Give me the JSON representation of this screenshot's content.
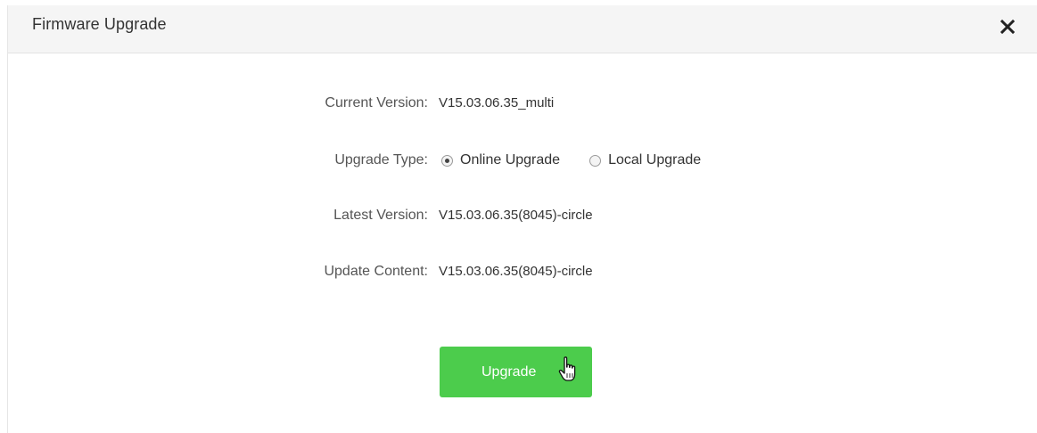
{
  "dialog": {
    "title": "Firmware Upgrade",
    "close_icon": "close-icon"
  },
  "fields": {
    "current_version": {
      "label": "Current Version:",
      "value": "V15.03.06.35_multi"
    },
    "upgrade_type": {
      "label": "Upgrade Type:",
      "options": [
        {
          "label": "Online Upgrade",
          "checked": true
        },
        {
          "label": "Local Upgrade",
          "checked": false
        }
      ]
    },
    "latest_version": {
      "label": "Latest Version:",
      "value": "V15.03.06.35(8045)-circle"
    },
    "update_content": {
      "label": "Update Content:",
      "value": "V15.03.06.35(8045)-circle"
    }
  },
  "actions": {
    "upgrade_label": "Upgrade",
    "cursor_icon": "hand-pointer-icon"
  },
  "colors": {
    "button_green": "#4ccc4c",
    "header_bg": "#f5f5f5"
  }
}
